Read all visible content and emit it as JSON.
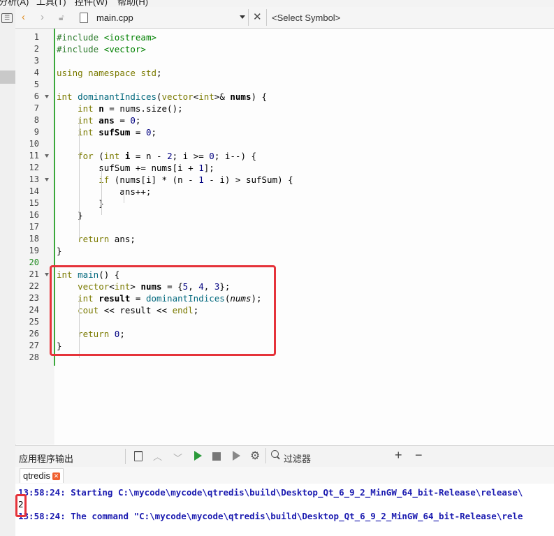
{
  "menubar": {
    "items": [
      "分析(A)",
      "工具(T)",
      "控件(W)",
      "帮助(H)"
    ]
  },
  "toolbar": {
    "file_name": "main.cpp",
    "symbol_placeholder": "<Select Symbol>",
    "icons": [
      "back-arrow-icon",
      "forward-arrow-icon",
      "lock-icon",
      "file-icon",
      "dropdown-icon",
      "close-icon"
    ]
  },
  "editor": {
    "current_line": 20,
    "lines": [
      {
        "n": "1",
        "c": "#include <iostream>"
      },
      {
        "n": "2",
        "c": "#include <vector>"
      },
      {
        "n": "3",
        "c": ""
      },
      {
        "n": "4",
        "c": "using namespace std;"
      },
      {
        "n": "5",
        "c": ""
      },
      {
        "n": "6",
        "c": "int dominantIndices(vector<int>& nums) {"
      },
      {
        "n": "7",
        "c": "    int n = nums.size();"
      },
      {
        "n": "8",
        "c": "    int ans = 0;"
      },
      {
        "n": "9",
        "c": "    int sufSum = 0;"
      },
      {
        "n": "10",
        "c": ""
      },
      {
        "n": "11",
        "c": "    for (int i = n - 2; i >= 0; i--) {"
      },
      {
        "n": "12",
        "c": "        sufSum += nums[i + 1];"
      },
      {
        "n": "13",
        "c": "        if (nums[i] * (n - 1 - i) > sufSum) {"
      },
      {
        "n": "14",
        "c": "            ans++;"
      },
      {
        "n": "15",
        "c": "        }"
      },
      {
        "n": "16",
        "c": "    }"
      },
      {
        "n": "17",
        "c": ""
      },
      {
        "n": "18",
        "c": "    return ans;"
      },
      {
        "n": "19",
        "c": "}"
      },
      {
        "n": "20",
        "c": ""
      },
      {
        "n": "21",
        "c": "int main() {"
      },
      {
        "n": "22",
        "c": "    vector<int> nums = {5, 4, 3};"
      },
      {
        "n": "23",
        "c": "    int result = dominantIndices(nums);"
      },
      {
        "n": "24",
        "c": "    cout << result << endl;"
      },
      {
        "n": "25",
        "c": ""
      },
      {
        "n": "26",
        "c": "    return 0;"
      },
      {
        "n": "27",
        "c": "}"
      },
      {
        "n": "28",
        "c": ""
      }
    ]
  },
  "output_panel": {
    "title": "应用程序输出",
    "filter_placeholder": "过滤器",
    "add_label": "+",
    "remove_label": "−",
    "tab_label": "qtredis",
    "lines": [
      "13:58:24: Starting C:\\mycode\\mycode\\qtredis\\build\\Desktop_Qt_6_9_2_MinGW_64_bit-Release\\release\\",
      "2",
      "13:58:24: The command \"C:\\mycode\\mycode\\qtredis\\build\\Desktop_Qt_6_9_2_MinGW_64_bit-Release\\rele"
    ]
  },
  "colors": {
    "highlight_box": "#e5333a",
    "gutter_marker": "#3ba83b",
    "output_text": "#1b1bb0"
  }
}
